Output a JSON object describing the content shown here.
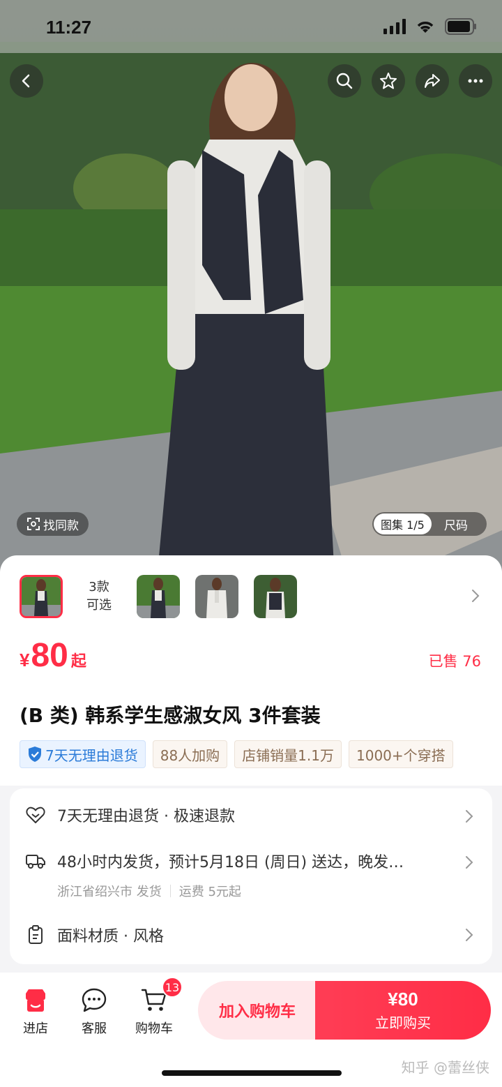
{
  "status": {
    "time": "11:27"
  },
  "hero": {
    "find_same": "找同款",
    "gallery_counter": "图集 1/5",
    "size_label": "尺码",
    "icons": [
      "back-icon",
      "search-icon",
      "star-icon",
      "share-icon",
      "more-icon"
    ]
  },
  "product": {
    "variant_count_line1": "3款",
    "variant_count_line2": "可选",
    "price_currency": "¥",
    "price_value": "80",
    "price_suffix": "起",
    "sold": "已售 76",
    "title": "(B 类) 韩系学生感淑女风 3件套装",
    "tags": [
      "7天无理由退货",
      "88人加购",
      "店铺销量1.1万",
      "1000+个穿搭"
    ]
  },
  "service": {
    "return_policy": "7天无理由退货 · 极速退款",
    "shipping": "48小时内发货，预计5月18日 (周日) 送达，晚发…",
    "origin": "浙江省绍兴市 发货",
    "shipping_fee": "运费 5元起",
    "material": "面料材质 · 风格"
  },
  "bottom_bar": {
    "shop": "进店",
    "service": "客服",
    "cart": "购物车",
    "cart_badge": "13",
    "add_to_cart": "加入购物车",
    "buy_price": "¥80",
    "buy_now": "立即购买"
  },
  "watermark": "知乎 @蕾丝侠",
  "colors": {
    "accent": "#ff2d46",
    "tag_blue": "#2b7bd8",
    "tag_brown": "#8a6d53"
  }
}
